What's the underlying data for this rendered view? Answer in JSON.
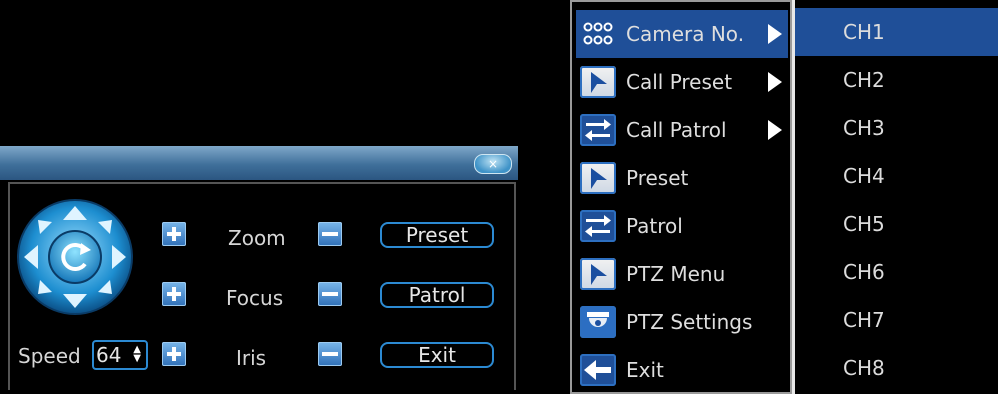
{
  "ptz": {
    "close_label": "×",
    "zoom_label": "Zoom",
    "focus_label": "Focus",
    "iris_label": "Iris",
    "speed_label": "Speed",
    "speed_value": "64",
    "preset_button": "Preset",
    "patrol_button": "Patrol",
    "exit_button": "Exit"
  },
  "menu": {
    "items": [
      {
        "label": "Camera No.",
        "icon": "grid-icon",
        "submenu": true,
        "selected": true
      },
      {
        "label": "Call Preset",
        "icon": "flag-icon",
        "submenu": true
      },
      {
        "label": "Call Patrol",
        "icon": "swap-arrows-icon",
        "submenu": true
      },
      {
        "label": "Preset",
        "icon": "flag-icon"
      },
      {
        "label": "Patrol",
        "icon": "swap-arrows-icon"
      },
      {
        "label": "PTZ Menu",
        "icon": "flag-icon"
      },
      {
        "label": "PTZ Settings",
        "icon": "dome-camera-icon"
      },
      {
        "label": "Exit",
        "icon": "back-arrow-icon"
      }
    ]
  },
  "submenu": {
    "items": [
      "CH1",
      "CH2",
      "CH3",
      "CH4",
      "CH5",
      "CH6",
      "CH7",
      "CH8"
    ],
    "selected_index": 0
  },
  "colors": {
    "highlight": "#1f4f98",
    "accent": "#2c8ad2",
    "titlebar": "#3f6f9a"
  }
}
